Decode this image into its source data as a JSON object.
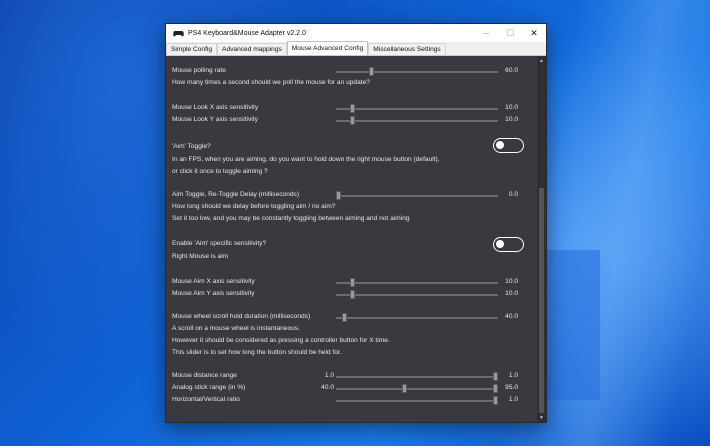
{
  "window": {
    "title": "PS4 Keyboard&Mouse Adapter v2.2.0",
    "minimize": "─",
    "maximize": "☐",
    "close": "✕"
  },
  "tabs": [
    {
      "label": "Simple Config"
    },
    {
      "label": "Advanced mappings"
    },
    {
      "label": "Mouse Advanced Config"
    },
    {
      "label": "Miscellaneous Settings"
    }
  ],
  "active_tab": "Mouse Advanced Config",
  "settings": {
    "polling_rate": {
      "label": "Mouse polling rate",
      "value": "60.0",
      "desc": "How many times a second should we poll the mouse for an update?"
    },
    "look_x": {
      "label": "Mouse Look X axis sensitivity",
      "value": "10.0"
    },
    "look_y": {
      "label": "Mouse Look Y axis sensitivity",
      "value": "10.0"
    },
    "aim_toggle": {
      "label": "'Aim' Toggle?",
      "desc1": "In an FPS, when you are aiming, do you want to hold down the right mouse button (default),",
      "desc2": "or click it once to toggle aiming ?",
      "enabled": false
    },
    "aim_delay": {
      "label": "Aim Toggle, Re-Toggle Delay (milliseconds)",
      "value": "0.0",
      "desc1": "How long should we delay before toggling aim / no aim?",
      "desc2": "Set it too low, and you may be constantly toggling between aiming and not aiming"
    },
    "aim_sensitivity": {
      "label": "Enable 'Aim' specific sensitivity?",
      "desc": "Right Mouse is aim",
      "enabled": false
    },
    "aim_x": {
      "label": "Mouse Aim X axis sensitivity",
      "value": "10.0"
    },
    "aim_y": {
      "label": "Mouse Aim Y axis sensitivity",
      "value": "10.0"
    },
    "scroll_hold": {
      "label": "Mouse wheel scroll hold duration (milliseconds)",
      "value": "40.0",
      "desc1": "A scroll on a mouse wheel is instantaneous.",
      "desc2": "However it should be considered as pressing a controller button for X time.",
      "desc3": "This slider is to set how long the button should be held for."
    },
    "distance_range": {
      "label": "Mouse distance range",
      "min_value": "1.0",
      "max_value": "1.0"
    },
    "analog_range": {
      "label": "Analog stick range (in %)",
      "min_value": "40.0",
      "max_value": "95.0"
    },
    "hv_ratio": {
      "label": "Horizontal/Vertical ratio",
      "value": "1.0"
    }
  },
  "colors": {
    "panel": "#3a3940",
    "text": "#e6e6e6",
    "track": "#6b6a70"
  }
}
